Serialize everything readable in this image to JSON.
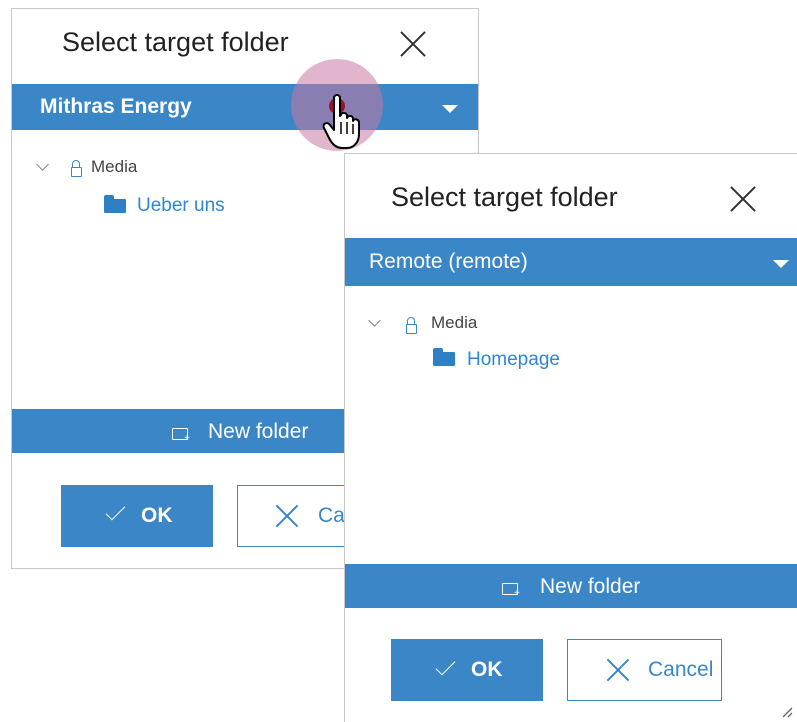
{
  "dialog_back": {
    "title": "Select target folder",
    "site_selector": {
      "label": "Mithras Energy"
    },
    "tree": {
      "root_label": "Media",
      "items": [
        {
          "label": "Ueber uns"
        }
      ]
    },
    "new_folder_label": "New folder",
    "ok_label": "OK",
    "cancel_label": "Ca"
  },
  "dialog_front": {
    "title": "Select target folder",
    "site_selector": {
      "label": "Remote (remote)"
    },
    "tree": {
      "root_label": "Media",
      "items": [
        {
          "label": "Homepage"
        }
      ]
    },
    "new_folder_label": "New folder",
    "ok_label": "OK",
    "cancel_label": "Cancel"
  },
  "colors": {
    "accent": "#3b86c6",
    "link": "#2f86d6",
    "cursor_highlight": "#c878a0"
  },
  "icons": [
    "close-icon",
    "chevron-down-icon",
    "lock-icon",
    "folder-icon",
    "new-folder-icon",
    "check-icon",
    "x-icon",
    "hand-cursor-icon",
    "resize-handle-icon"
  ]
}
